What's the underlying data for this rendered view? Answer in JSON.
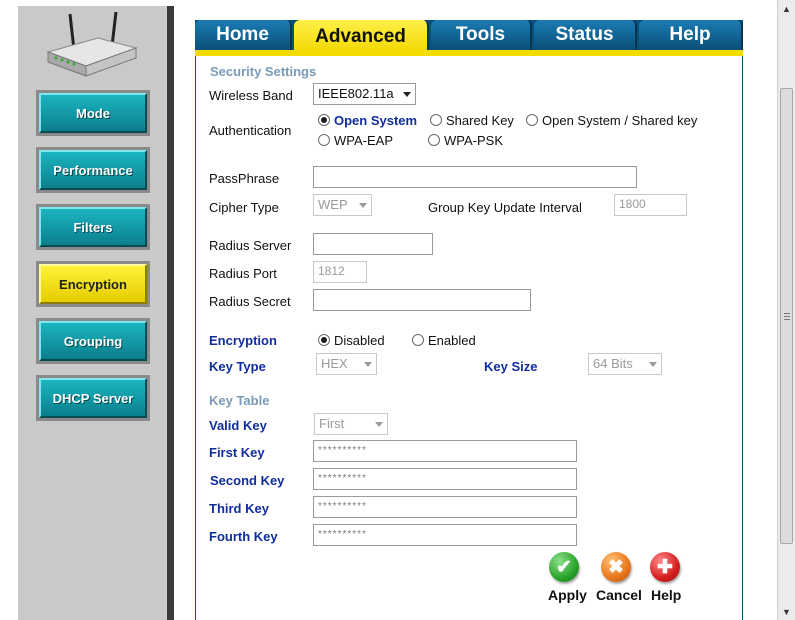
{
  "tabs": [
    {
      "label": "Home",
      "active": false
    },
    {
      "label": "Advanced",
      "active": true
    },
    {
      "label": "Tools",
      "active": false
    },
    {
      "label": "Status",
      "active": false
    },
    {
      "label": "Help",
      "active": false
    }
  ],
  "sidebar": {
    "items": [
      {
        "label": "Mode",
        "active": false
      },
      {
        "label": "Performance",
        "active": false
      },
      {
        "label": "Filters",
        "active": false
      },
      {
        "label": "Encryption",
        "active": true
      },
      {
        "label": "Grouping",
        "active": false
      },
      {
        "label": "DHCP Server",
        "active": false
      }
    ]
  },
  "security": {
    "title": "Security Settings",
    "wireless_band_label": "Wireless Band",
    "wireless_band_value": "IEEE802.11a",
    "authentication_label": "Authentication",
    "auth_options": [
      "Open System",
      "Shared Key",
      "Open System / Shared key",
      "WPA-EAP",
      "WPA-PSK"
    ],
    "auth_selected": "Open System",
    "passphrase_label": "PassPhrase",
    "passphrase_value": "",
    "cipher_type_label": "Cipher Type",
    "cipher_type_value": "WEP",
    "group_key_label": "Group Key Update Interval",
    "group_key_value": "1800",
    "radius_server_label": "Radius Server",
    "radius_server_value": "",
    "radius_port_label": "Radius Port",
    "radius_port_value": "1812",
    "radius_secret_label": "Radius Secret",
    "radius_secret_value": ""
  },
  "encryption": {
    "label": "Encryption",
    "options": [
      "Disabled",
      "Enabled"
    ],
    "selected": "Disabled",
    "key_type_label": "Key Type",
    "key_type_value": "HEX",
    "key_size_label": "Key Size",
    "key_size_value": "64 Bits"
  },
  "key_table": {
    "title": "Key Table",
    "valid_key_label": "Valid Key",
    "valid_key_value": "First",
    "keys": [
      {
        "label": "First Key",
        "value": "**********"
      },
      {
        "label": "Second Key",
        "value": "**********"
      },
      {
        "label": "Third Key",
        "value": "**********"
      },
      {
        "label": "Fourth Key",
        "value": "**********"
      }
    ]
  },
  "actions": {
    "apply_label": "Apply",
    "cancel_label": "Cancel",
    "help_label": "Help"
  },
  "colors": {
    "tab_blue": "#0a4f78",
    "active_yellow": "#f3dc00",
    "sidebar_teal": "#0f9aa6",
    "label_blue": "#102e9c",
    "apply_green": "#2aa32a",
    "cancel_orange": "#e8761c",
    "help_red": "#d42020"
  }
}
